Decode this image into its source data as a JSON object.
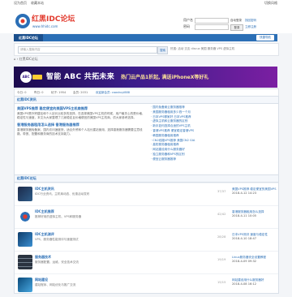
{
  "topbar": {
    "fav": "设为首页",
    "bookmark": "收藏本站",
    "right": "切换风格"
  },
  "logo": {
    "title": "红黑IDC论坛",
    "sub": "www.hhidc.com"
  },
  "login": {
    "user_label": "用户名",
    "pass_label": "密码",
    "remember": "自动登录",
    "register": "立即注册",
    "find_pw": "找回密码",
    "login_btn": "登录"
  },
  "nav": {
    "home": "红黑IDC论坛",
    "quick": "快捷导航"
  },
  "search": {
    "placeholder": "请输入搜索内容",
    "button": "搜索",
    "hot": "热搜: 活动 交友 discuz 美国 服务器 VPS 虚拟主机"
  },
  "breadcrumb": "⌂ › 红黑IDC论坛",
  "banner": {
    "logo": "ABC",
    "title": "智能 ABC 共拓未来",
    "sub": "热门云产品1折起, 满送iPhoneX等好礼"
  },
  "info": {
    "today": "今日: 0",
    "yesterday": "昨日: 0",
    "posts": "帖子: 1954",
    "members": "会员: 2031",
    "newest": "欢迎新会员: caoshuyi888"
  },
  "news": {
    "head": "红黑IDC资讯",
    "headline1": "美国VPS推荐 稳定便宜的美国VPS主机商推荐",
    "para1": "美国VPS是外贸建站和个人站长比较多的选择，在选择美国VPS主机的时候，用户最关心的是价格、稳定性与速度，本文为大家整理了几家稳定且价格便宜的美国VPS主机商，供大家参考选择。",
    "headline2": "香港服务器租用怎么选择 香港服务器推荐",
    "para2": "香港服务器免备案，国内访问速度快，适合外贸和个人站长建站使用，选择香港服务器需要注意线路、带宽、配置和服务商的技术支持能力。",
    "links": [
      "· 国内免备案云服务器推荐",
      "· 美国服务器租用多少钱一个月",
      "· 日本VPS哪家好 日本VPS推荐",
      "· 虚拟主机和云服务器的区别",
      "· 新手如何选择合适的VPS主机",
      "· 香港VPS推荐 便宜稳定香港VPS",
      "· 韩国服务器租用推荐",
      "· CN2线路VPS推荐 美国CN2 GIA",
      "· 高防服务器租用推荐",
      "· 网站建设用什么服务器好",
      "· 独立服务器和VPS的区别",
      "· 便宜云服务器推荐"
    ]
  },
  "forum": {
    "head": "红黑IDC论坛",
    "rows": [
      {
        "name": "IDC主机资讯",
        "desc": "IDC行业资讯、主机商动态、优惠活动发布",
        "stat": "37/37",
        "last": "美国VPS推荐 稳定便宜的美国VPS",
        "time": "2018-4-12 14:23"
      },
      {
        "name": "IDC主机推荐",
        "desc": "推荐好用的虚拟主机、VPS和服务器",
        "stat": "42/42",
        "last": "香港服务器租用怎么选择",
        "time": "2018-4-11 10:05"
      },
      {
        "name": "IDC主机测评",
        "desc": "VPS、服务器性能测评与速度测试",
        "stat": "28/28",
        "last": "日本VPS测评 速度与稳定性",
        "time": "2018-4-10 18:47"
      },
      {
        "name": "服务器技术",
        "desc": "服务器配置、运维、安全技术交流",
        "stat": "19/19",
        "last": "Linux服务器安全设置教程",
        "time": "2018-4-09 09:32"
      },
      {
        "name": "网站建设",
        "desc": "建站程序、网站优化与推广交流",
        "stat": "15/15",
        "last": "网站建设用什么服务器好",
        "time": "2018-4-08 16:12"
      }
    ]
  },
  "colors": {
    "accent": "#2b6fb6",
    "nav": "#2b6fb6",
    "banner": "#3a1c8a"
  }
}
